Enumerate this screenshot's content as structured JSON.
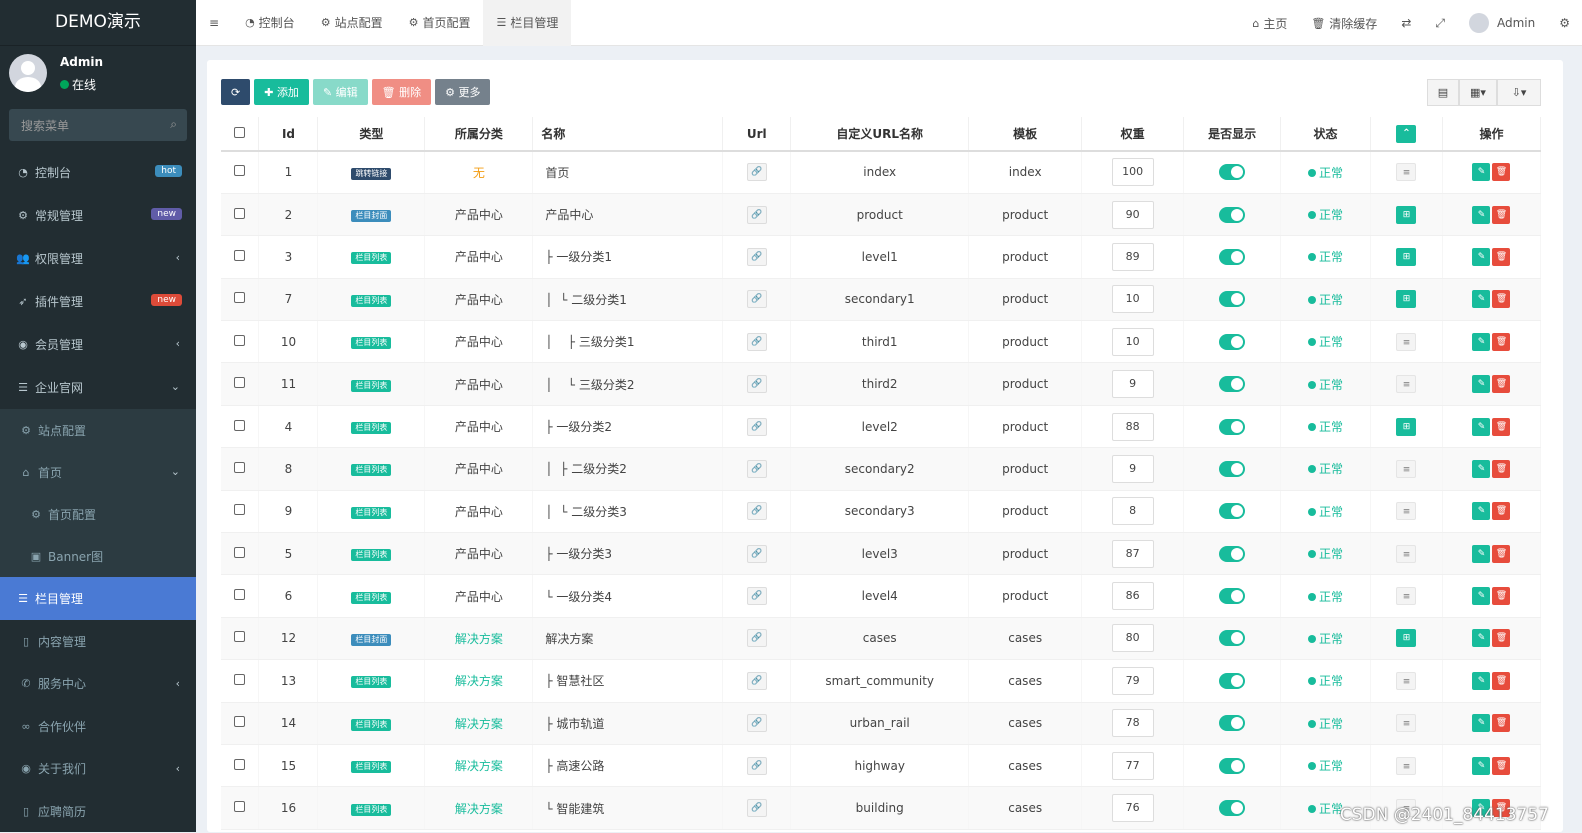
{
  "sidebar": {
    "brand": "DEMO演示",
    "user": {
      "name": "Admin",
      "status": "在线"
    },
    "search_placeholder": "搜索菜单",
    "items": [
      {
        "label": "控制台",
        "icon": "dashboard-icon",
        "badge": "hot",
        "badge_color": "#3c8dbc"
      },
      {
        "label": "常规管理",
        "icon": "cogs-icon",
        "badge": "new",
        "badge_color": "#605ca8"
      },
      {
        "label": "权限管理",
        "icon": "group-icon",
        "arrow": "‹"
      },
      {
        "label": "插件管理",
        "icon": "rocket-icon",
        "badge": "new",
        "badge_color": "#dd4b39"
      },
      {
        "label": "会员管理",
        "icon": "user-circle-icon",
        "arrow": "‹"
      },
      {
        "label": "企业官网",
        "icon": "list-icon",
        "arrow": "⌄"
      }
    ],
    "sub_items": [
      {
        "label": "站点配置",
        "icon": "cogs-icon"
      },
      {
        "label": "首页",
        "icon": "home-icon",
        "arrow": "⌄"
      },
      {
        "label": "首页配置",
        "icon": "cog-icon"
      },
      {
        "label": "Banner图",
        "icon": "image-icon"
      }
    ],
    "active_item": {
      "label": "栏目管理",
      "icon": "list-icon"
    },
    "bottom_items": [
      {
        "label": "内容管理",
        "icon": "file-icon"
      },
      {
        "label": "服务中心",
        "icon": "phone-icon",
        "arrow": "‹"
      },
      {
        "label": "合作伙伴",
        "icon": "handshake-icon"
      },
      {
        "label": "关于我们",
        "icon": "user-circle-icon",
        "arrow": "‹"
      },
      {
        "label": "应聘简历",
        "icon": "file-icon"
      }
    ]
  },
  "topbar": {
    "tabs": [
      {
        "label": "控制台",
        "icon": "dashboard-icon"
      },
      {
        "label": "站点配置",
        "icon": "cogs-icon"
      },
      {
        "label": "首页配置",
        "icon": "cog-icon"
      },
      {
        "label": "栏目管理",
        "icon": "list-icon"
      }
    ],
    "home": "主页",
    "clear_cache": "清除缓存",
    "admin": "Admin"
  },
  "toolbar": {
    "add": "添加",
    "edit": "编辑",
    "delete": "删除",
    "more": "更多"
  },
  "table": {
    "headers": [
      "Id",
      "类型",
      "所属分类",
      "名称",
      "Url",
      "自定义URL名称",
      "模板",
      "权重",
      "是否显示",
      "状态",
      "操作"
    ],
    "rows": [
      {
        "id": "1",
        "type": "跳转链接",
        "tclass": "t-jump",
        "parent": "无",
        "pclass": "parent-none",
        "name": "首页",
        "url_name": "index",
        "template": "index",
        "weight": "100",
        "status": "正常",
        "action": "list"
      },
      {
        "id": "2",
        "type": "栏目封面",
        "tclass": "t-cover",
        "parent": "产品中心",
        "pclass": "",
        "name": "产品中心",
        "url_name": "product",
        "template": "product",
        "weight": "90",
        "status": "正常",
        "action": "sitemap"
      },
      {
        "id": "3",
        "type": "栏目列表",
        "tclass": "t-list",
        "parent": "产品中心",
        "pclass": "",
        "name": "├ 一级分类1",
        "url_name": "level1",
        "template": "product",
        "weight": "89",
        "status": "正常",
        "action": "sitemap"
      },
      {
        "id": "7",
        "type": "栏目列表",
        "tclass": "t-list",
        "parent": "产品中心",
        "pclass": "",
        "name": "│  └ 二级分类1",
        "url_name": "secondary1",
        "template": "product",
        "weight": "10",
        "status": "正常",
        "action": "sitemap"
      },
      {
        "id": "10",
        "type": "栏目列表",
        "tclass": "t-list",
        "parent": "产品中心",
        "pclass": "",
        "name": "│    ├ 三级分类1",
        "url_name": "third1",
        "template": "product",
        "weight": "10",
        "status": "正常",
        "action": "list"
      },
      {
        "id": "11",
        "type": "栏目列表",
        "tclass": "t-list",
        "parent": "产品中心",
        "pclass": "",
        "name": "│    └ 三级分类2",
        "url_name": "third2",
        "template": "product",
        "weight": "9",
        "status": "正常",
        "action": "list"
      },
      {
        "id": "4",
        "type": "栏目列表",
        "tclass": "t-list",
        "parent": "产品中心",
        "pclass": "",
        "name": "├ 一级分类2",
        "url_name": "level2",
        "template": "product",
        "weight": "88",
        "status": "正常",
        "action": "sitemap"
      },
      {
        "id": "8",
        "type": "栏目列表",
        "tclass": "t-list",
        "parent": "产品中心",
        "pclass": "",
        "name": "│  ├ 二级分类2",
        "url_name": "secondary2",
        "template": "product",
        "weight": "9",
        "status": "正常",
        "action": "list"
      },
      {
        "id": "9",
        "type": "栏目列表",
        "tclass": "t-list",
        "parent": "产品中心",
        "pclass": "",
        "name": "│  └ 二级分类3",
        "url_name": "secondary3",
        "template": "product",
        "weight": "8",
        "status": "正常",
        "action": "list"
      },
      {
        "id": "5",
        "type": "栏目列表",
        "tclass": "t-list",
        "parent": "产品中心",
        "pclass": "",
        "name": "├ 一级分类3",
        "url_name": "level3",
        "template": "product",
        "weight": "87",
        "status": "正常",
        "action": "list"
      },
      {
        "id": "6",
        "type": "栏目列表",
        "tclass": "t-list",
        "parent": "产品中心",
        "pclass": "",
        "name": "└ 一级分类4",
        "url_name": "level4",
        "template": "product",
        "weight": "86",
        "status": "正常",
        "action": "list"
      },
      {
        "id": "12",
        "type": "栏目封面",
        "tclass": "t-cover",
        "parent": "解决方案",
        "pclass": "parent-link",
        "name": "解决方案",
        "url_name": "cases",
        "template": "cases",
        "weight": "80",
        "status": "正常",
        "action": "sitemap"
      },
      {
        "id": "13",
        "type": "栏目列表",
        "tclass": "t-list",
        "parent": "解决方案",
        "pclass": "parent-link",
        "name": "├ 智慧社区",
        "url_name": "smart_community",
        "template": "cases",
        "weight": "79",
        "status": "正常",
        "action": "list"
      },
      {
        "id": "14",
        "type": "栏目列表",
        "tclass": "t-list",
        "parent": "解决方案",
        "pclass": "parent-link",
        "name": "├ 城市轨道",
        "url_name": "urban_rail",
        "template": "cases",
        "weight": "78",
        "status": "正常",
        "action": "list"
      },
      {
        "id": "15",
        "type": "栏目列表",
        "tclass": "t-list",
        "parent": "解决方案",
        "pclass": "parent-link",
        "name": "├ 高速公路",
        "url_name": "highway",
        "template": "cases",
        "weight": "77",
        "status": "正常",
        "action": "list"
      },
      {
        "id": "16",
        "type": "栏目列表",
        "tclass": "t-list",
        "parent": "解决方案",
        "pclass": "parent-link",
        "name": "└ 智能建筑",
        "url_name": "building",
        "template": "cases",
        "weight": "76",
        "status": "正常",
        "action": "list"
      }
    ]
  },
  "watermark": "CSDN @2401_84413757"
}
